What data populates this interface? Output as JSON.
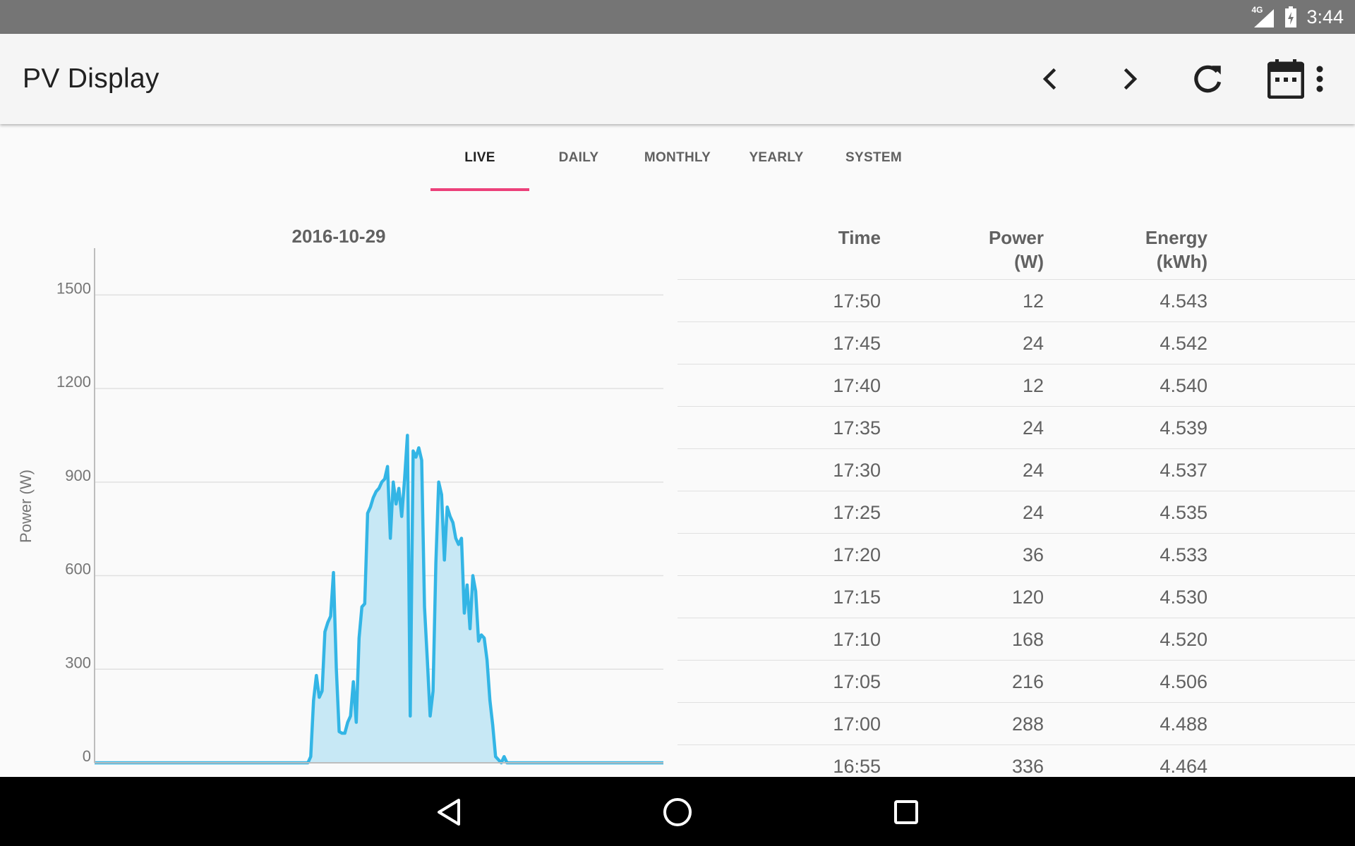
{
  "status_bar": {
    "network": "4G",
    "time": "3:44"
  },
  "app_bar": {
    "title": "PV Display",
    "actions": [
      "chevron-left-icon",
      "chevron-right-icon",
      "refresh-icon",
      "calendar-icon",
      "more-vert-icon"
    ]
  },
  "tabs": [
    {
      "label": "LIVE",
      "active": true
    },
    {
      "label": "DAILY",
      "active": false
    },
    {
      "label": "MONTHLY",
      "active": false
    },
    {
      "label": "YEARLY",
      "active": false
    },
    {
      "label": "SYSTEM",
      "active": false
    }
  ],
  "colors": {
    "accent": "#ec407a",
    "line": "#33b5e5",
    "fill": "#c7e8f5",
    "status_bar": "#757575",
    "app_bar": "#f5f5f5"
  },
  "table": {
    "headers": {
      "time": "Time",
      "power_line1": "Power",
      "power_line2": "(W)",
      "energy_line1": "Energy",
      "energy_line2": "(kWh)"
    },
    "rows": [
      {
        "time": "17:50",
        "power": "12",
        "energy": "4.543"
      },
      {
        "time": "17:45",
        "power": "24",
        "energy": "4.542"
      },
      {
        "time": "17:40",
        "power": "12",
        "energy": "4.540"
      },
      {
        "time": "17:35",
        "power": "24",
        "energy": "4.539"
      },
      {
        "time": "17:30",
        "power": "24",
        "energy": "4.537"
      },
      {
        "time": "17:25",
        "power": "24",
        "energy": "4.535"
      },
      {
        "time": "17:20",
        "power": "36",
        "energy": "4.533"
      },
      {
        "time": "17:15",
        "power": "120",
        "energy": "4.530"
      },
      {
        "time": "17:10",
        "power": "168",
        "energy": "4.520"
      },
      {
        "time": "17:05",
        "power": "216",
        "energy": "4.506"
      },
      {
        "time": "17:00",
        "power": "288",
        "energy": "4.488"
      },
      {
        "time": "16:55",
        "power": "336",
        "energy": "4.464"
      }
    ]
  },
  "chart_data": {
    "type": "area",
    "title": "2016-10-29",
    "xlabel": "",
    "ylabel": "Power (W)",
    "ylim": [
      0,
      1650
    ],
    "yticks": [
      0,
      300,
      600,
      900,
      1200,
      1500
    ],
    "grid": true,
    "xlim": [
      0,
      1000
    ],
    "series": [
      {
        "x": [
          0,
          50,
          100,
          150,
          200,
          250,
          300,
          350,
          375,
          380,
          385,
          390,
          395,
          400,
          405,
          410,
          415,
          420,
          425,
          430,
          435,
          440,
          445,
          450,
          455,
          460,
          465,
          470,
          475,
          480,
          485,
          490,
          495,
          500,
          505,
          510,
          515,
          520,
          525,
          530,
          535,
          540,
          545,
          550,
          555,
          560,
          565,
          570,
          575,
          580,
          585,
          590,
          595,
          600,
          605,
          610,
          615,
          620,
          625,
          630,
          635,
          640,
          645,
          650,
          655,
          660,
          665,
          670,
          675,
          680,
          685,
          690,
          695,
          700,
          705,
          710,
          715,
          720,
          725,
          730,
          735,
          740,
          745,
          750,
          755,
          760,
          765,
          770,
          775,
          780,
          785,
          790,
          795,
          800,
          850,
          900,
          950,
          1000
        ],
        "values": [
          0,
          0,
          0,
          0,
          0,
          0,
          0,
          0,
          0,
          20,
          200,
          280,
          210,
          230,
          420,
          450,
          470,
          610,
          300,
          100,
          95,
          95,
          130,
          150,
          260,
          130,
          400,
          500,
          510,
          800,
          820,
          850,
          870,
          880,
          900,
          910,
          950,
          720,
          900,
          830,
          880,
          790,
          910,
          1050,
          150,
          1000,
          980,
          1010,
          970,
          500,
          330,
          150,
          230,
          640,
          900,
          860,
          650,
          820,
          790,
          770,
          720,
          700,
          720,
          480,
          570,
          430,
          600,
          550,
          390,
          410,
          400,
          330,
          200,
          120,
          20,
          10,
          0,
          20,
          0,
          0,
          0,
          0,
          0,
          0,
          0,
          0,
          0,
          0,
          0,
          0,
          0,
          0,
          0,
          0,
          0,
          0,
          0,
          0
        ]
      }
    ]
  }
}
